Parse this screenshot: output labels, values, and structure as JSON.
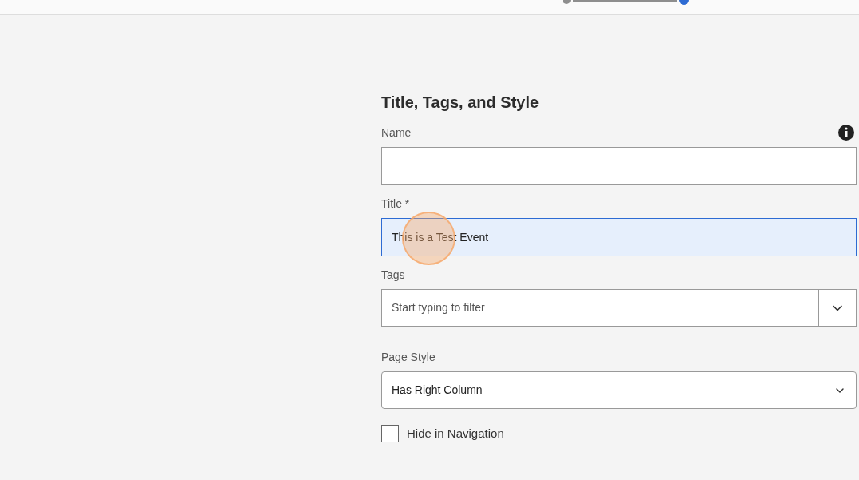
{
  "stepper": {
    "steps": [
      {
        "selected": false
      },
      {
        "selected": true
      }
    ]
  },
  "section": {
    "heading": "Title, Tags, and Style"
  },
  "fields": [
    {
      "kind": "text",
      "label": "Name",
      "info": true
    },
    {
      "kind": "text",
      "label": "Title *",
      "value": "This is a Test Event",
      "focused": true
    },
    {
      "kind": "combobox",
      "label": "Tags",
      "placeholder": "Start typing to filter"
    },
    {
      "kind": "select",
      "label": "Page Style",
      "value": "Has Right Column"
    },
    {
      "kind": "checkbox",
      "label": "Hide in Navigation",
      "checked": false
    }
  ],
  "click_indicator": true
}
